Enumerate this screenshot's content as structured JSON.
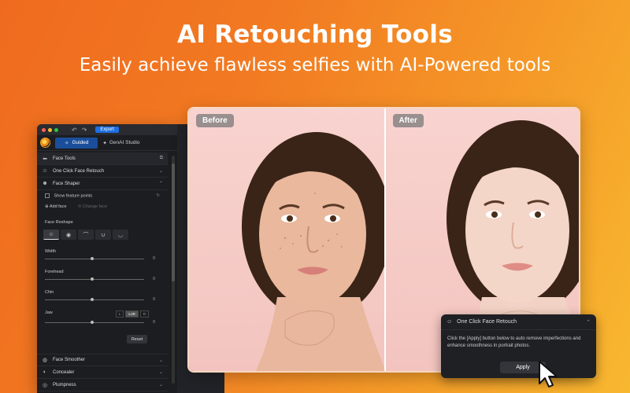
{
  "hero": {
    "title": "AI Retouching Tools",
    "subtitle": "Easily achieve flawless selfies with AI-Powered tools"
  },
  "window": {
    "export_label": "Export",
    "tabs": [
      {
        "label": "Guided",
        "active": true
      },
      {
        "label": "GenAI Studio",
        "active": false
      }
    ]
  },
  "panel": {
    "title": "Face Tools",
    "items": {
      "one_click": "One Click Face Retouch",
      "face_shaper": "Face Shaper",
      "show_points": "Show feature points",
      "add_face": "Add face",
      "change_face": "Change face",
      "face_reshape": "Face Reshape",
      "reset": "Reset",
      "face_smoother": "Face Smoother",
      "concealer": "Concealer",
      "plumpness": "Plumpness"
    },
    "sliders": [
      {
        "label": "Width",
        "value": "0",
        "level": 0.5
      },
      {
        "label": "Forehead",
        "value": "0",
        "level": 0.5
      },
      {
        "label": "Chin",
        "value": "0",
        "level": 0.5
      },
      {
        "label": "Jaw",
        "value": "0",
        "level": 0.5
      }
    ],
    "jaw_toggle": {
      "left": "L",
      "both": "L≡R",
      "right": "R"
    }
  },
  "photos": {
    "before_label": "Before",
    "after_label": "After"
  },
  "popup": {
    "title": "One Click Face Retouch",
    "body": "Click the [Apply] button below to auto remove imperfections and enhance smoothness in portrait photos.",
    "apply_label": "Apply"
  }
}
